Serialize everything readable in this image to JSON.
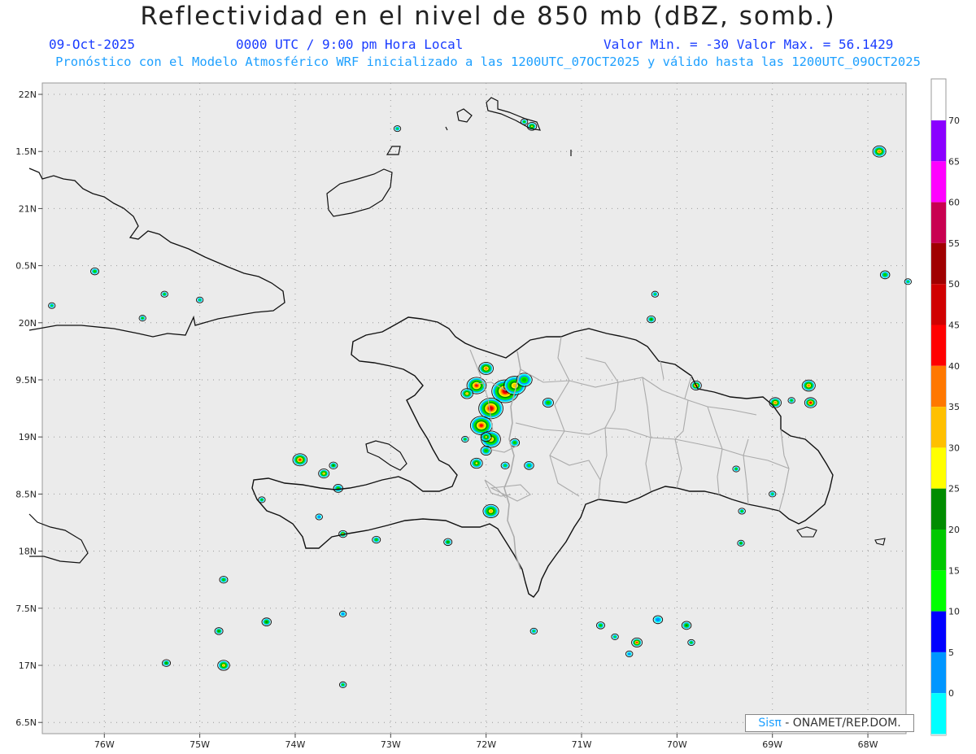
{
  "header": {
    "title": "Reflectividad en el nivel de 850 mb (dBZ, somb.)",
    "date": "09-Oct-2025",
    "time": "0000 UTC / 9:00 pm Hora Local",
    "minmax": "Valor Min. = -30  Valor Max. = 56.1429",
    "forecast": "Pronóstico con el Modelo Atmosférico WRF inicializado a las 1200UTC_07OCT2025 y válido hasta las  1200UTC_09OCT2025"
  },
  "map": {
    "lat_labels": [
      "22N",
      "1.5N",
      "21N",
      "0.5N",
      "20N",
      "9.5N",
      "19N",
      "8.5N",
      "18N",
      "7.5N",
      "17N",
      "6.5N"
    ],
    "lon_labels": [
      "76W",
      "75W",
      "74W",
      "73W",
      "72W",
      "71W",
      "70W",
      "69W",
      "68W"
    ],
    "lat_range": [
      16.5,
      22.0
    ],
    "lon_range": [
      -76.65,
      -67.6
    ]
  },
  "colorbar": {
    "labels": [
      "70",
      "65",
      "60",
      "55",
      "50",
      "45",
      "40",
      "35",
      "30",
      "25",
      "20",
      "15",
      "10",
      "5",
      "0"
    ],
    "colors": [
      "#8a00ff",
      "#ff00ff",
      "#c80050",
      "#a00000",
      "#d00000",
      "#ff0000",
      "#ff7800",
      "#ffc000",
      "#ffff00",
      "#008c00",
      "#00c800",
      "#00ff00",
      "#0000ff",
      "#0096ff",
      "#00ffff"
    ]
  },
  "credit": {
    "brand": "Sisπ",
    "text": "- ONAMET/REP.DOM."
  },
  "cells": [
    {
      "lon": -71.8,
      "lat": 19.4,
      "r": 1.0,
      "max": 50
    },
    {
      "lon": -71.95,
      "lat": 19.25,
      "r": 0.9,
      "max": 50
    },
    {
      "lon": -72.1,
      "lat": 19.45,
      "r": 0.7,
      "max": 45
    },
    {
      "lon": -71.7,
      "lat": 19.45,
      "r": 0.8,
      "max": 35
    },
    {
      "lon": -71.6,
      "lat": 19.5,
      "r": 0.55,
      "max": 20
    },
    {
      "lon": -72.05,
      "lat": 19.1,
      "r": 0.8,
      "max": 45
    },
    {
      "lon": -71.95,
      "lat": 18.98,
      "r": 0.7,
      "max": 35
    },
    {
      "lon": -72.0,
      "lat": 19.6,
      "r": 0.5,
      "max": 40
    },
    {
      "lon": -72.2,
      "lat": 19.38,
      "r": 0.4,
      "max": 35
    },
    {
      "lon": -72.0,
      "lat": 19.0,
      "r": 0.35,
      "max": 30
    },
    {
      "lon": -71.95,
      "lat": 18.35,
      "r": 0.55,
      "max": 35
    },
    {
      "lon": -72.1,
      "lat": 18.77,
      "r": 0.4,
      "max": 30
    },
    {
      "lon": -72.0,
      "lat": 18.88,
      "r": 0.35,
      "max": 20
    },
    {
      "lon": -71.7,
      "lat": 18.95,
      "r": 0.3,
      "max": 20
    },
    {
      "lon": -71.35,
      "lat": 19.3,
      "r": 0.35,
      "max": 20
    },
    {
      "lon": -71.55,
      "lat": 18.75,
      "r": 0.3,
      "max": 15
    },
    {
      "lon": -71.8,
      "lat": 18.75,
      "r": 0.25,
      "max": 15
    },
    {
      "lon": -73.95,
      "lat": 18.8,
      "r": 0.5,
      "max": 45
    },
    {
      "lon": -73.7,
      "lat": 18.68,
      "r": 0.35,
      "max": 35
    },
    {
      "lon": -73.6,
      "lat": 18.75,
      "r": 0.25,
      "max": 25
    },
    {
      "lon": -73.55,
      "lat": 18.55,
      "r": 0.3,
      "max": 20
    },
    {
      "lon": -73.5,
      "lat": 18.15,
      "r": 0.25,
      "max": 35
    },
    {
      "lon": -73.15,
      "lat": 18.1,
      "r": 0.25,
      "max": 20
    },
    {
      "lon": -72.4,
      "lat": 18.08,
      "r": 0.25,
      "max": 25
    },
    {
      "lon": -74.75,
      "lat": 17.75,
      "r": 0.25,
      "max": 20
    },
    {
      "lon": -74.3,
      "lat": 17.38,
      "r": 0.3,
      "max": 25
    },
    {
      "lon": -74.8,
      "lat": 17.3,
      "r": 0.25,
      "max": 25
    },
    {
      "lon": -74.75,
      "lat": 17.0,
      "r": 0.4,
      "max": 35
    },
    {
      "lon": -75.35,
      "lat": 17.02,
      "r": 0.25,
      "max": 25
    },
    {
      "lon": -73.5,
      "lat": 16.83,
      "r": 0.2,
      "max": 20
    },
    {
      "lon": -71.5,
      "lat": 17.3,
      "r": 0.2,
      "max": 15
    },
    {
      "lon": -70.8,
      "lat": 17.35,
      "r": 0.25,
      "max": 20
    },
    {
      "lon": -70.65,
      "lat": 17.25,
      "r": 0.2,
      "max": 15
    },
    {
      "lon": -70.42,
      "lat": 17.2,
      "r": 0.35,
      "max": 45
    },
    {
      "lon": -70.5,
      "lat": 17.1,
      "r": 0.2,
      "max": 10
    },
    {
      "lon": -70.2,
      "lat": 17.4,
      "r": 0.3,
      "max": 10
    },
    {
      "lon": -69.9,
      "lat": 17.35,
      "r": 0.3,
      "max": 25
    },
    {
      "lon": -69.85,
      "lat": 17.2,
      "r": 0.2,
      "max": 20
    },
    {
      "lon": -69.8,
      "lat": 19.45,
      "r": 0.35,
      "max": 45
    },
    {
      "lon": -68.97,
      "lat": 19.3,
      "r": 0.4,
      "max": 40
    },
    {
      "lon": -68.62,
      "lat": 19.45,
      "r": 0.45,
      "max": 40
    },
    {
      "lon": -68.6,
      "lat": 19.3,
      "r": 0.4,
      "max": 50
    },
    {
      "lon": -68.8,
      "lat": 19.32,
      "r": 0.2,
      "max": 20
    },
    {
      "lon": -69.32,
      "lat": 18.35,
      "r": 0.2,
      "max": 20
    },
    {
      "lon": -69.33,
      "lat": 18.07,
      "r": 0.2,
      "max": 25
    },
    {
      "lon": -69.38,
      "lat": 18.72,
      "r": 0.2,
      "max": 20
    },
    {
      "lon": -70.27,
      "lat": 20.03,
      "r": 0.25,
      "max": 25
    },
    {
      "lon": -67.88,
      "lat": 21.5,
      "r": 0.45,
      "max": 40
    },
    {
      "lon": -67.82,
      "lat": 20.42,
      "r": 0.3,
      "max": 20
    },
    {
      "lon": -71.52,
      "lat": 21.72,
      "r": 0.3,
      "max": 30
    },
    {
      "lon": -71.6,
      "lat": 21.76,
      "r": 0.2,
      "max": 20
    },
    {
      "lon": -72.93,
      "lat": 21.7,
      "r": 0.15,
      "max": 15
    },
    {
      "lon": -76.1,
      "lat": 20.45,
      "r": 0.25,
      "max": 20
    },
    {
      "lon": -75.37,
      "lat": 20.25,
      "r": 0.2,
      "max": 20
    },
    {
      "lon": -76.55,
      "lat": 20.15,
      "r": 0.15,
      "max": 15
    },
    {
      "lon": -75.6,
      "lat": 20.04,
      "r": 0.15,
      "max": 20
    },
    {
      "lon": -75.0,
      "lat": 20.2,
      "r": 0.15,
      "max": 15
    },
    {
      "lon": -74.35,
      "lat": 18.45,
      "r": 0.15,
      "max": 20
    },
    {
      "lon": -73.75,
      "lat": 18.3,
      "r": 0.15,
      "max": 10
    },
    {
      "lon": -72.22,
      "lat": 18.98,
      "r": 0.2,
      "max": 20
    },
    {
      "lon": -70.23,
      "lat": 20.25,
      "r": 0.12,
      "max": 15
    },
    {
      "lon": -69.0,
      "lat": 18.5,
      "r": 0.15,
      "max": 15
    },
    {
      "lon": -67.58,
      "lat": 20.36,
      "r": 0.15,
      "max": 15
    },
    {
      "lon": -73.5,
      "lat": 17.45,
      "r": 0.1,
      "max": 10
    }
  ]
}
